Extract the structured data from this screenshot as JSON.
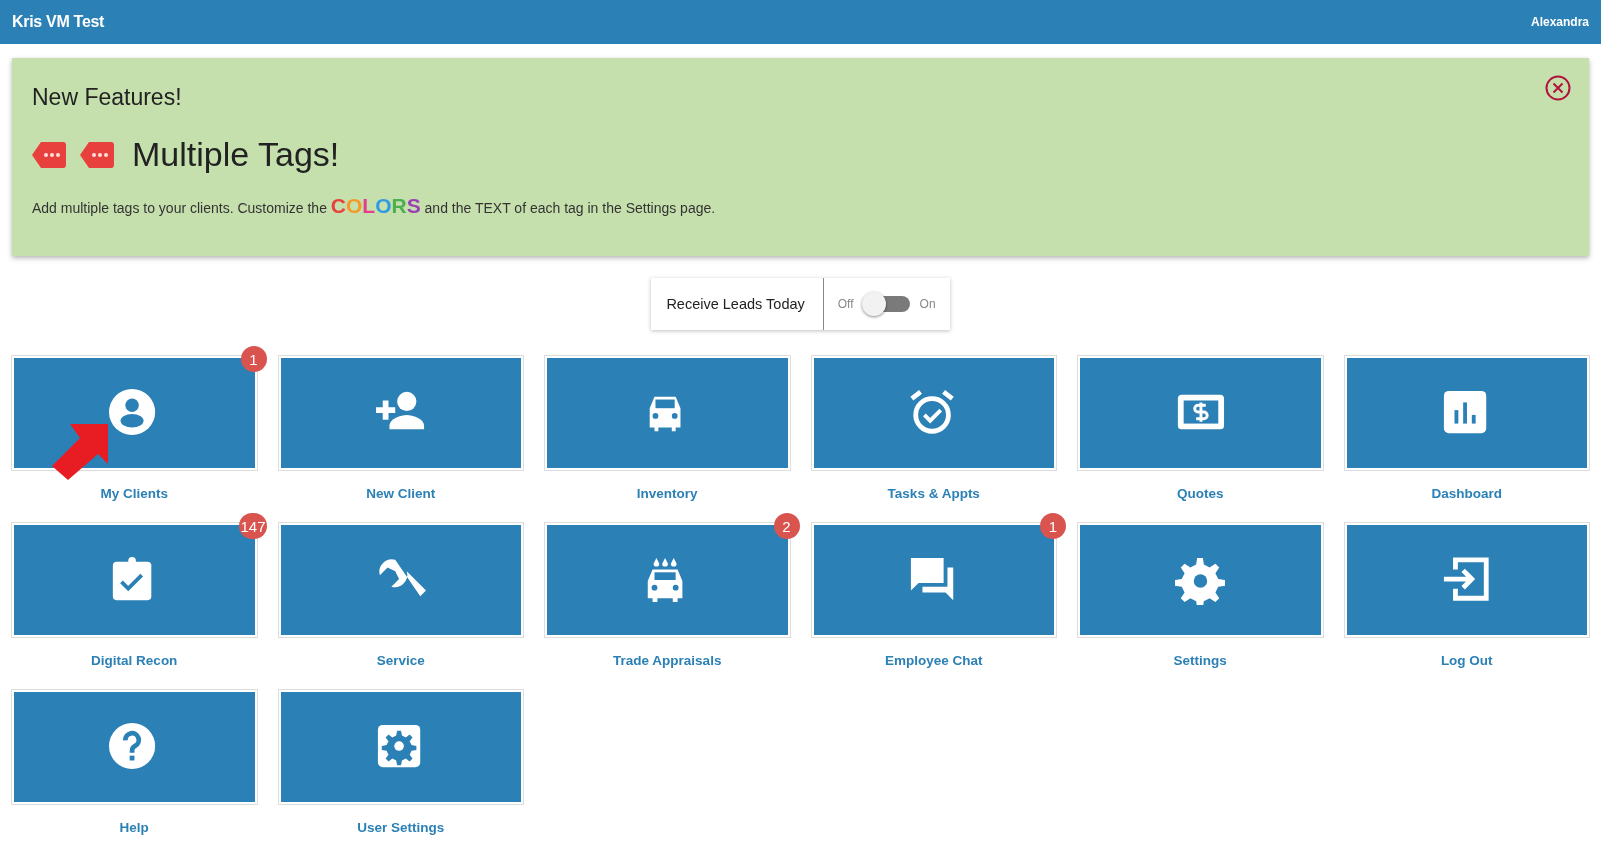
{
  "top_bar": {
    "title": "Kris VM Test",
    "user": "Alexandra"
  },
  "banner": {
    "heading": "New Features!",
    "feature_title": "Multiple Tags!",
    "text_before": "Add multiple tags to your clients. Customize the",
    "highlight": "COLORS",
    "text_after": "and the TEXT of each tag in the Settings page.",
    "tags": [
      {
        "kind": "tag"
      },
      {
        "kind": "tag"
      }
    ]
  },
  "leads_toggle": {
    "label": "Receive Leads Today",
    "off_label": "Off",
    "on_label": "On",
    "on": false
  },
  "tiles": [
    {
      "kind": "person",
      "label": "My Clients",
      "badge": "1",
      "pointer": true
    },
    {
      "kind": "add-person",
      "label": "New Client"
    },
    {
      "kind": "car",
      "label": "Inventory"
    },
    {
      "kind": "alarm",
      "label": "Tasks & Appts"
    },
    {
      "kind": "dollar",
      "label": "Quotes"
    },
    {
      "kind": "chart",
      "label": "Dashboard"
    },
    {
      "kind": "clipboard",
      "label": "Digital Recon",
      "badge": "147"
    },
    {
      "kind": "wrench",
      "label": "Service"
    },
    {
      "kind": "carwash",
      "label": "Trade Appraisals",
      "badge": "2"
    },
    {
      "kind": "chat",
      "label": "Employee Chat",
      "badge": "1"
    },
    {
      "kind": "gear",
      "label": "Settings"
    },
    {
      "kind": "logout",
      "label": "Log Out"
    },
    {
      "kind": "help",
      "label": "Help"
    },
    {
      "kind": "user-settings",
      "label": "User Settings"
    }
  ]
}
